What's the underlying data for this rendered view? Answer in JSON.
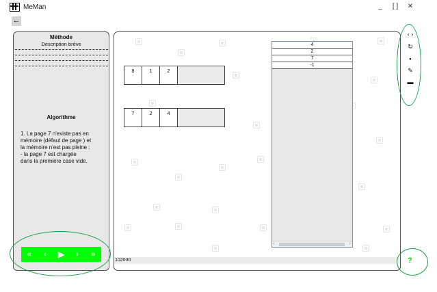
{
  "window": {
    "title": "MeMan",
    "minimize": "_",
    "maximize": "[ ]",
    "close": "✕"
  },
  "nav": {
    "back": "←"
  },
  "left_panel": {
    "method_title": "Méthode",
    "method_description": "Description brève",
    "algorithm_title": "Algorithme",
    "algorithm_lines": [
      "1. La page 7 n'existe pas en",
      "mémoire (défaut de page )  et",
      "la mémoire n'est pas pleine :",
      "-            la page 7  est chargée",
      "dans la première case vide."
    ],
    "controls": {
      "first": "«",
      "prev": "‹",
      "play": "▶",
      "next": "›",
      "last": "»"
    }
  },
  "main_panel": {
    "frames_row_1": [
      "8",
      "1",
      "2"
    ],
    "frames_row_2": [
      "7",
      "2",
      "4"
    ],
    "reference_list": [
      "4",
      "2",
      "7",
      "-1"
    ],
    "scroll_left": "‹",
    "scroll_right": "›",
    "status_text": "102030"
  },
  "toolbar": {
    "expand_icon": "‹ ›",
    "refresh_icon": "↻",
    "save_icon": "▪",
    "edit_icon": "✎",
    "folder_icon": "▬"
  },
  "help": {
    "label": "?"
  },
  "colors": {
    "controls_bg": "#00ff00",
    "annotation": "#1aa34a",
    "panel_bg": "#e8e8e8"
  }
}
